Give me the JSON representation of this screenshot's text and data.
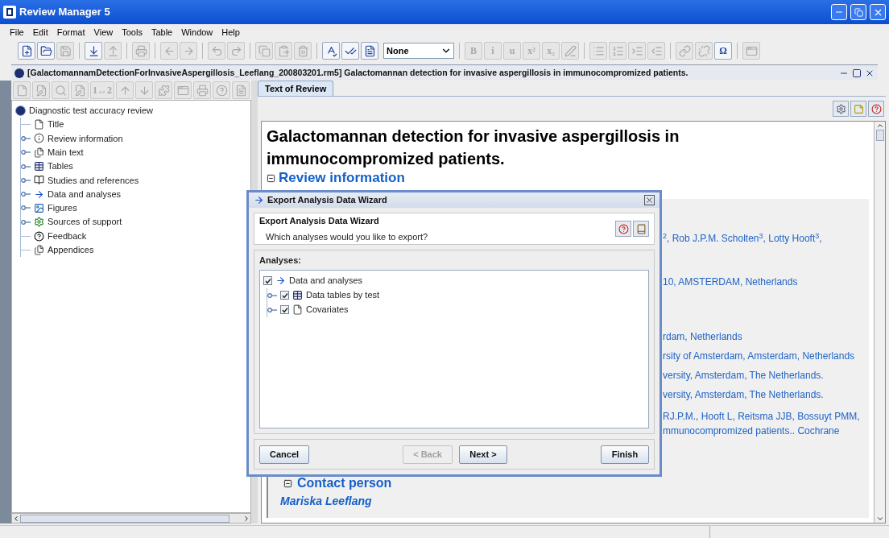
{
  "window": {
    "title": "Review Manager 5"
  },
  "menu": [
    "File",
    "Edit",
    "Format",
    "View",
    "Tools",
    "Table",
    "Window",
    "Help"
  ],
  "toolbar": [
    {
      "kind": "new",
      "disabled": false
    },
    {
      "kind": "open",
      "disabled": false
    },
    {
      "kind": "save",
      "disabled": true
    },
    {
      "kind": "separator"
    },
    {
      "kind": "import",
      "disabled": false
    },
    {
      "kind": "export",
      "disabled": true
    },
    {
      "kind": "separator"
    },
    {
      "kind": "print",
      "disabled": true
    },
    {
      "kind": "separator"
    },
    {
      "kind": "back",
      "disabled": true
    },
    {
      "kind": "forward",
      "disabled": true
    },
    {
      "kind": "separator"
    },
    {
      "kind": "undo",
      "disabled": true
    },
    {
      "kind": "redo",
      "disabled": true
    },
    {
      "kind": "separator"
    },
    {
      "kind": "copy",
      "disabled": true
    },
    {
      "kind": "paste",
      "disabled": true
    },
    {
      "kind": "delete",
      "disabled": true
    },
    {
      "kind": "separator"
    },
    {
      "kind": "spell",
      "disabled": false
    },
    {
      "kind": "spell-check",
      "disabled": false
    },
    {
      "kind": "notes",
      "disabled": false
    },
    {
      "kind": "style",
      "value": "None"
    },
    {
      "kind": "separator"
    },
    {
      "kind": "text",
      "label": "B",
      "disabled": true
    },
    {
      "kind": "text",
      "label": "i",
      "disabled": true
    },
    {
      "kind": "text",
      "label": "u",
      "disabled": true
    },
    {
      "kind": "text",
      "label": "x²",
      "disabled": true
    },
    {
      "kind": "text",
      "label": "x₂",
      "disabled": true
    },
    {
      "kind": "pen",
      "disabled": true
    },
    {
      "kind": "separator"
    },
    {
      "kind": "bullets",
      "disabled": true
    },
    {
      "kind": "numbers",
      "disabled": true
    },
    {
      "kind": "indent",
      "disabled": true
    },
    {
      "kind": "outdent",
      "disabled": true
    },
    {
      "kind": "separator"
    },
    {
      "kind": "link",
      "disabled": true
    },
    {
      "kind": "unlink",
      "disabled": true
    },
    {
      "kind": "text",
      "label": "Ω",
      "disabled": false
    },
    {
      "kind": "separator"
    },
    {
      "kind": "window",
      "disabled": true
    }
  ],
  "document": {
    "title": "[GalactomannamDetectionForInvasiveAspergillosis_Leeflang_200803201.rm5] Galactomannan detection for invasive aspergillosis in immunocompromized patients.",
    "toolbar": [
      {
        "kind": "page",
        "disabled": true
      },
      {
        "kind": "edit",
        "disabled": true
      },
      {
        "kind": "search",
        "disabled": true
      },
      {
        "kind": "edit-note",
        "disabled": true
      },
      {
        "kind": "text",
        "label": "1↔2",
        "disabled": true
      },
      {
        "kind": "up",
        "disabled": true
      },
      {
        "kind": "down",
        "disabled": true
      },
      {
        "kind": "puzzle",
        "disabled": true
      },
      {
        "kind": "window",
        "disabled": true
      },
      {
        "kind": "print",
        "disabled": true
      },
      {
        "kind": "help",
        "disabled": true
      },
      {
        "kind": "notes-doc",
        "disabled": true
      }
    ],
    "tree": {
      "label": "Diagnostic test accuracy review",
      "kind": "review",
      "children": [
        {
          "label": "Title",
          "kind": "page",
          "expandable": false
        },
        {
          "label": "Review information",
          "kind": "info",
          "expandable": true
        },
        {
          "label": "Main text",
          "kind": "pages",
          "expandable": true
        },
        {
          "label": "Tables",
          "kind": "table",
          "expandable": true
        },
        {
          "label": "Studies and references",
          "kind": "book",
          "expandable": true
        },
        {
          "label": "Data and analyses",
          "kind": "flow",
          "expandable": true
        },
        {
          "label": "Figures",
          "kind": "picture",
          "expandable": true
        },
        {
          "label": "Sources of support",
          "kind": "support",
          "expandable": true
        },
        {
          "label": "Feedback",
          "kind": "feedback",
          "expandable": false
        },
        {
          "label": "Appendices",
          "kind": "pages",
          "expandable": false
        }
      ]
    },
    "tabs": [
      {
        "label": "Text of Review",
        "selected": true
      }
    ],
    "content": {
      "heading": "Galactomannan detection for invasive aspergillosis in immunocompromized patients.",
      "section": "Review information",
      "fragments": [
        "$^{2}$, Rob J.P.M. Scholten$^{3}$, Lotty Hooft$^{3}$,",
        "10, AMSTERDAM, Netherlands",
        "rdam, Netherlands",
        "rsity of Amsterdam, Amsterdam, Netherlands",
        "versity, Amsterdam, The Netherlands.",
        "versity, Amsterdam, The Netherlands.",
        "RJ.P.M., Hooft L, Reitsma JJB, Bossuyt PMM,",
        "mmunocompromized patients.. Cochrane"
      ],
      "contact_heading": "Contact person",
      "contact_name": "Mariska Leeflang"
    }
  },
  "dialog": {
    "title": "Export Analysis Data Wizard",
    "heading": "Export Analysis Data Wizard",
    "subtitle": "Which analyses would you like to export?",
    "list_label": "Analyses:",
    "tree": {
      "label": "Data and analyses",
      "kind": "flow",
      "checked": true,
      "children": [
        {
          "label": "Data tables by test",
          "kind": "table",
          "checked": true,
          "expandable": true
        },
        {
          "label": "Covariates",
          "kind": "page",
          "checked": true,
          "expandable": true
        }
      ]
    },
    "buttons": [
      {
        "label": "Cancel",
        "disabled": false
      },
      {
        "label": "< Back",
        "disabled": true
      },
      {
        "label": "Next >",
        "disabled": false
      },
      {
        "label": "Finish",
        "disabled": false
      }
    ]
  }
}
